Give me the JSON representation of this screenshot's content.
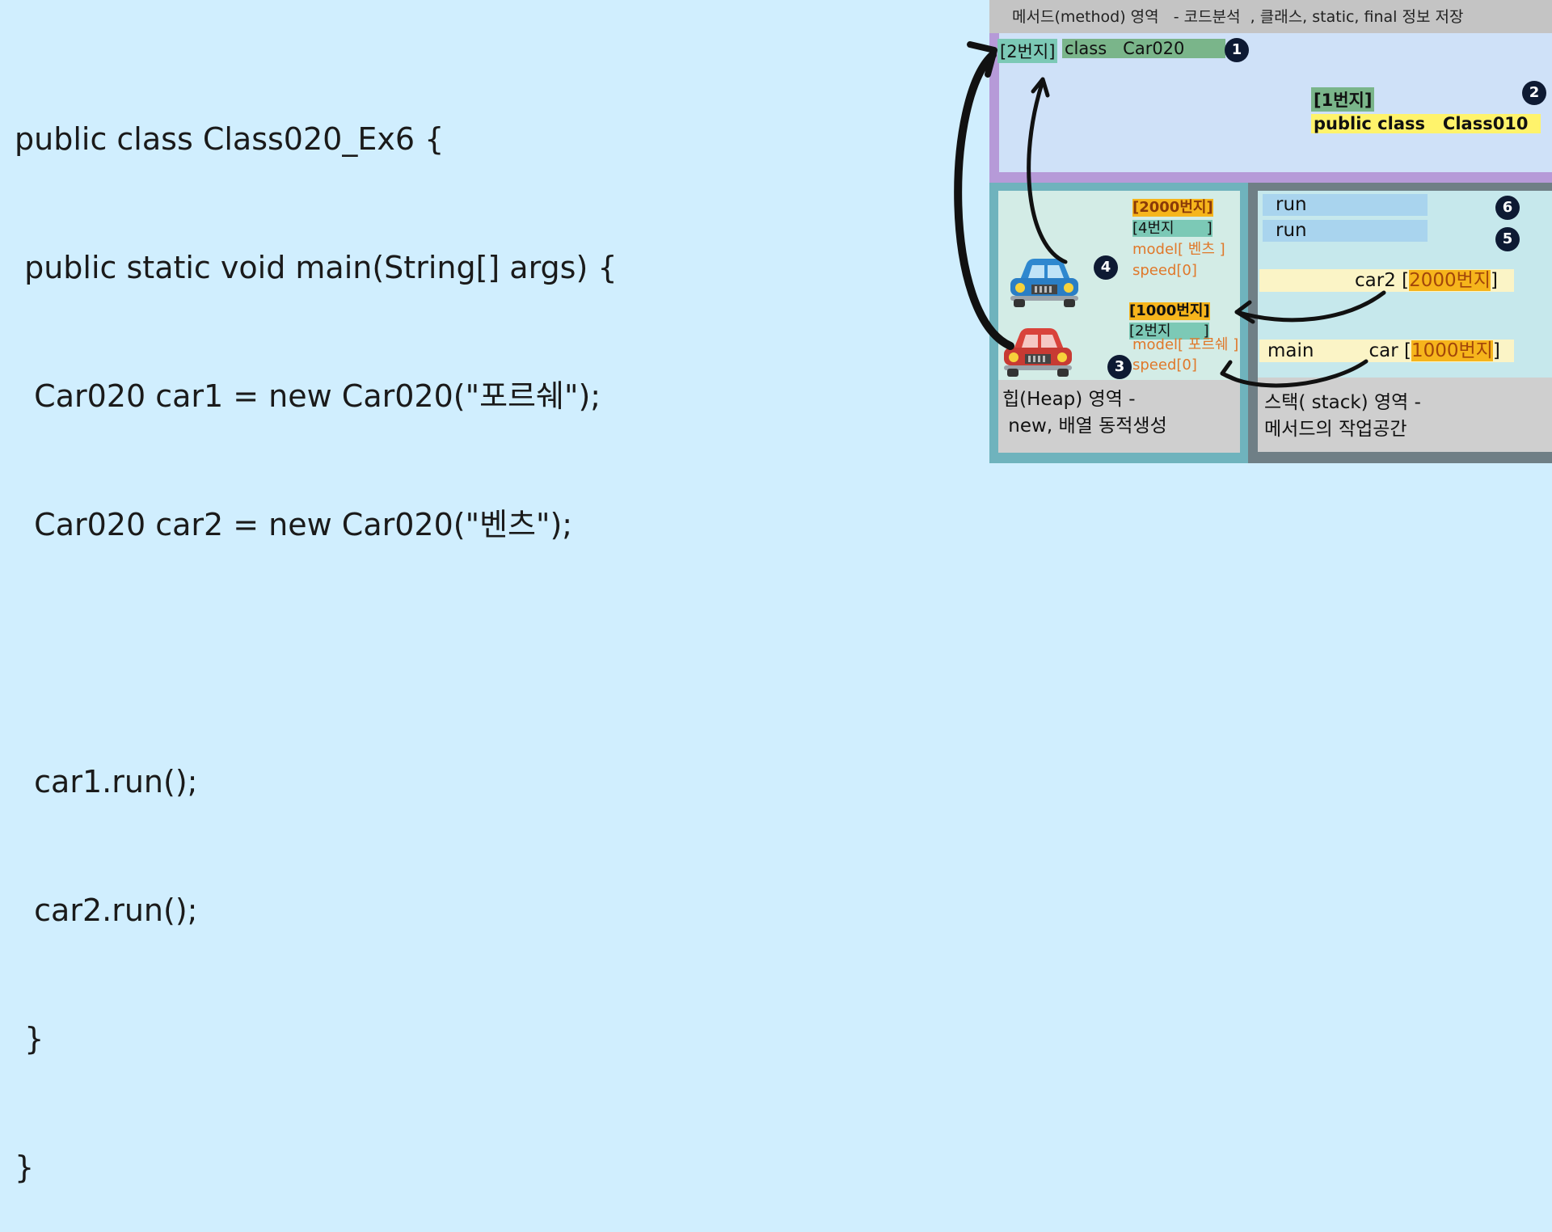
{
  "code": {
    "lines": [
      "public class Class020_Ex6 {",
      " public static void main(String[] args) {",
      "  Car020 car1 = new Car020(\"포르쉐\");",
      "  Car020 car2 = new Car020(\"벤츠\");",
      "",
      "  car1.run();",
      "  car2.run();",
      " }",
      "}"
    ]
  },
  "method_area": {
    "title": "메서드(method) 영역   - 코드분석  , 클래스, static, final 정보 저장",
    "car_class": {
      "address": "[2번지]",
      "label": "class   Car020"
    },
    "main_class": {
      "address": "[1번지]",
      "label": "public class   Class010"
    }
  },
  "heap": {
    "label_line1": "힙(Heap) 영역 -",
    "label_line2": " new, 배열 동적생성",
    "object_2000": {
      "address": "[2000번지]",
      "class_ref": "[4번지       ]",
      "model": "model[ 벤츠 ]",
      "speed": "speed[0]"
    },
    "object_1000": {
      "address": "[1000번지]",
      "class_ref": "[2번지       ]",
      "model": "model[ 포르쉐 ]",
      "speed": "speed[0]"
    }
  },
  "stack": {
    "label_line1": "스택( stack) 영역 -",
    "label_line2": "메서드의 작업공간",
    "frames": [
      "run",
      "run"
    ],
    "car2_ref": {
      "name": "car2",
      "address": "2000번지"
    },
    "main_frame": {
      "name": "main",
      "var": "car",
      "address": "1000번지"
    }
  },
  "badges": [
    "1",
    "2",
    "3",
    "4",
    "5",
    "6"
  ],
  "colors": {
    "background": "#d0eefe",
    "method_area": "#b69ad8",
    "heap_frame": "#6fb3bd",
    "stack_frame": "#6f7f86",
    "address_highlight": "#f6b51c",
    "class_highlight": "#7cc9b6",
    "class_yellow": "#fff36b"
  },
  "icons": [
    "blue-car-icon",
    "red-car-icon"
  ]
}
